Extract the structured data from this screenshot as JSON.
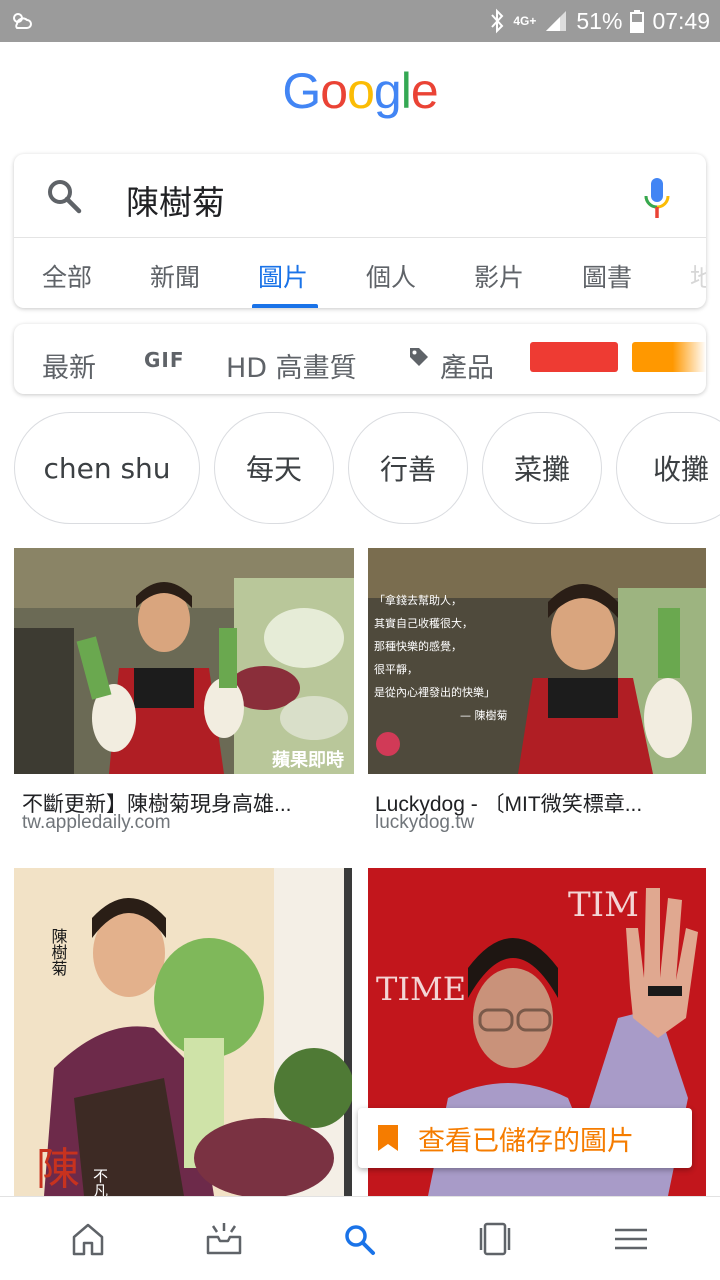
{
  "status_bar": {
    "network": "4G+",
    "battery": "51%",
    "time": "07:49"
  },
  "logo": {
    "letters": [
      "G",
      "o",
      "o",
      "g",
      "l",
      "e"
    ],
    "colors": [
      "#4285f4",
      "#ea4335",
      "#fbbc05",
      "#4285f4",
      "#34a853",
      "#ea4335"
    ]
  },
  "search": {
    "query": "陳樹菊"
  },
  "tabs": [
    {
      "label": "全部",
      "active": false
    },
    {
      "label": "新聞",
      "active": false
    },
    {
      "label": "圖片",
      "active": true
    },
    {
      "label": "個人",
      "active": false
    },
    {
      "label": "影片",
      "active": false
    },
    {
      "label": "圖書",
      "active": false
    },
    {
      "label": "地",
      "active": false
    }
  ],
  "filters": {
    "latest": "最新",
    "gif": "GIF",
    "hd": "HD 高畫質",
    "product": "產品",
    "color_swatches": [
      "#ee3b33",
      "#ff9800"
    ]
  },
  "chips": [
    "chen shu",
    "每天",
    "行善",
    "菜攤",
    "收攤"
  ],
  "results": [
    {
      "title": "不斷更新】陳樹菊現身高雄...",
      "site": "tw.appledaily.com",
      "watermark": "蘋果即時"
    },
    {
      "title": "Luckydog - 〔MIT微笑標章...",
      "site": "luckydog.tw",
      "quote_lines": [
        "「拿錢去幫助人，",
        "其實自己收穫很大，",
        "那種快樂的感覺，",
        "很平靜，",
        "是從內心裡發出的快樂」",
        "— 陳樹菊"
      ]
    },
    {
      "title": "",
      "site": "",
      "cover_text": "陳樹菊",
      "cover_big": "陳",
      "cover_side": "不凡"
    },
    {
      "title": "",
      "site": "",
      "banner_top": "TIM",
      "banner_mid": "TIME"
    }
  ],
  "saved_pill": {
    "label": "查看已儲存的圖片"
  },
  "colors": {
    "accent": "#1a73e8",
    "saved": "#f57c00"
  }
}
